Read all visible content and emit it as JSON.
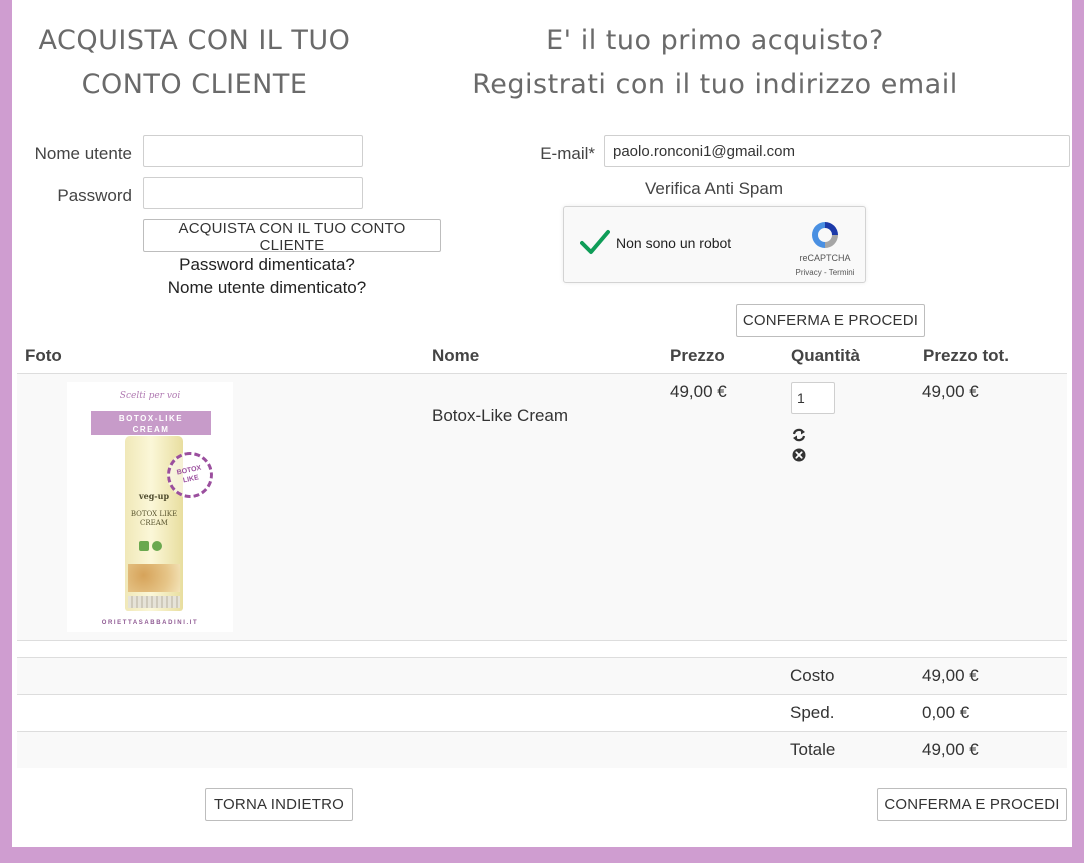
{
  "login": {
    "heading_line1": "ACQUISTA CON IL TUO",
    "heading_line2": "CONTO CLIENTE",
    "username_label": "Nome utente",
    "username_value": "",
    "password_label": "Password",
    "password_value": "",
    "submit_label": "ACQUISTA CON IL TUO CONTO CLIENTE",
    "forgot_password": "Password dimenticata?",
    "forgot_username": "Nome utente dimenticato?"
  },
  "register": {
    "heading_line1": "E' il tuo primo acquisto?",
    "heading_line2": "Registrati con il tuo indirizzo email",
    "email_label": "E-mail*",
    "email_value": "paolo.ronconi1@gmail.com",
    "antispam_label": "Verifica Anti Spam",
    "recaptcha": {
      "checkbox_label": "Non sono un robot",
      "brand": "reCAPTCHA",
      "privacy": "Privacy",
      "separator": " - ",
      "terms": "Termini",
      "checked": true
    },
    "confirm_label": "CONFERMA E PROCEDI"
  },
  "cart": {
    "headers": {
      "photo": "Foto",
      "name": "Nome",
      "price": "Prezzo",
      "quantity": "Quantità",
      "total": "Prezzo tot."
    },
    "items": [
      {
        "name": "Botox-Like Cream",
        "price": "49,00 €",
        "quantity": "1",
        "total": "49,00 €",
        "image": {
          "top_script": "Scelti per voi",
          "banner_line1": "BOTOX-LIKE",
          "banner_line2": "CREAM",
          "stamp_line1": "BOTOX",
          "stamp_line2": "LIKE",
          "bottle_brand": "veg-up",
          "bottle_line1": "BOTOX LIKE",
          "bottle_line2": "CREAM",
          "footer": "ORIETTASABBADINI.IT"
        },
        "update_icon": "refresh-icon",
        "remove_icon": "remove-circle-icon"
      }
    ],
    "summary": {
      "cost_label": "Costo",
      "cost_value": "49,00 €",
      "shipping_label": "Sped.",
      "shipping_value": "0,00 €",
      "total_label": "Totale",
      "total_value": "49,00 €"
    }
  },
  "footer": {
    "back_label": "TORNA INDIETRO",
    "confirm_label": "CONFERMA E PROCEDI"
  },
  "colors": {
    "page_border": "#cf9dd0",
    "banner_purple": "#c79bc9",
    "recaptcha_check": "#0f9d58"
  }
}
